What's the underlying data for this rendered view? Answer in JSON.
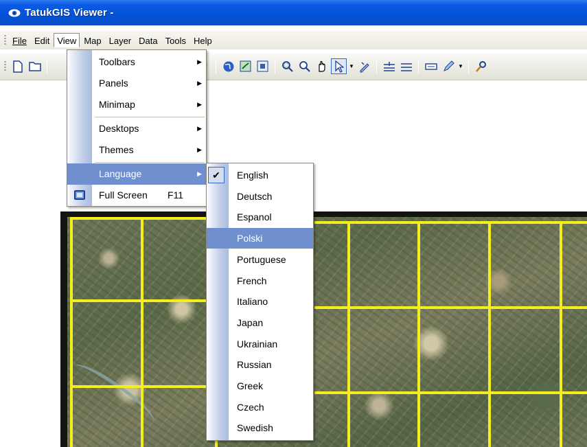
{
  "window": {
    "title": "TatukGIS Viewer -"
  },
  "menubar": {
    "items": [
      "File",
      "Edit",
      "View",
      "Map",
      "Layer",
      "Data",
      "Tools",
      "Help"
    ]
  },
  "toolbar": {
    "icons": [
      "new-document-icon",
      "open-folder-icon",
      "disabled-icon",
      "globe-icon",
      "zoom-extent-icon",
      "zoom-layer-icon",
      "zoom-window-icon",
      "zoom-icon",
      "hand-pan-icon",
      "select-arrow-icon",
      "dropdown-arrow-icon",
      "edit-icon",
      "distance-icon",
      "line-width-icon",
      "legend-icon",
      "pencil-icon",
      "dropdown-arrow-icon",
      "tool-icon"
    ]
  },
  "view_menu": {
    "items": [
      {
        "label": "Toolbars",
        "submenu": true
      },
      {
        "label": "Panels",
        "submenu": true
      },
      {
        "label": "Minimap",
        "submenu": true
      },
      {
        "label": "Desktops",
        "submenu": true
      },
      {
        "label": "Themes",
        "submenu": true
      },
      {
        "label": "Language",
        "submenu": true,
        "highlighted": true
      },
      {
        "label": "Full Screen",
        "shortcut": "F11"
      }
    ]
  },
  "language_menu": {
    "checked": "English",
    "highlighted": "Polski",
    "items": [
      "English",
      "Deutsch",
      "Espanol",
      "Polski",
      "Portuguese",
      "French",
      "Italiano",
      "Japan",
      "Ukrainian",
      "Russian",
      "Greek",
      "Czech",
      "Swedish"
    ]
  },
  "colors": {
    "title_bar": "#0552d8",
    "menu_highlight": "#6f8fcf",
    "grid_lines": "#f5ee1f"
  }
}
